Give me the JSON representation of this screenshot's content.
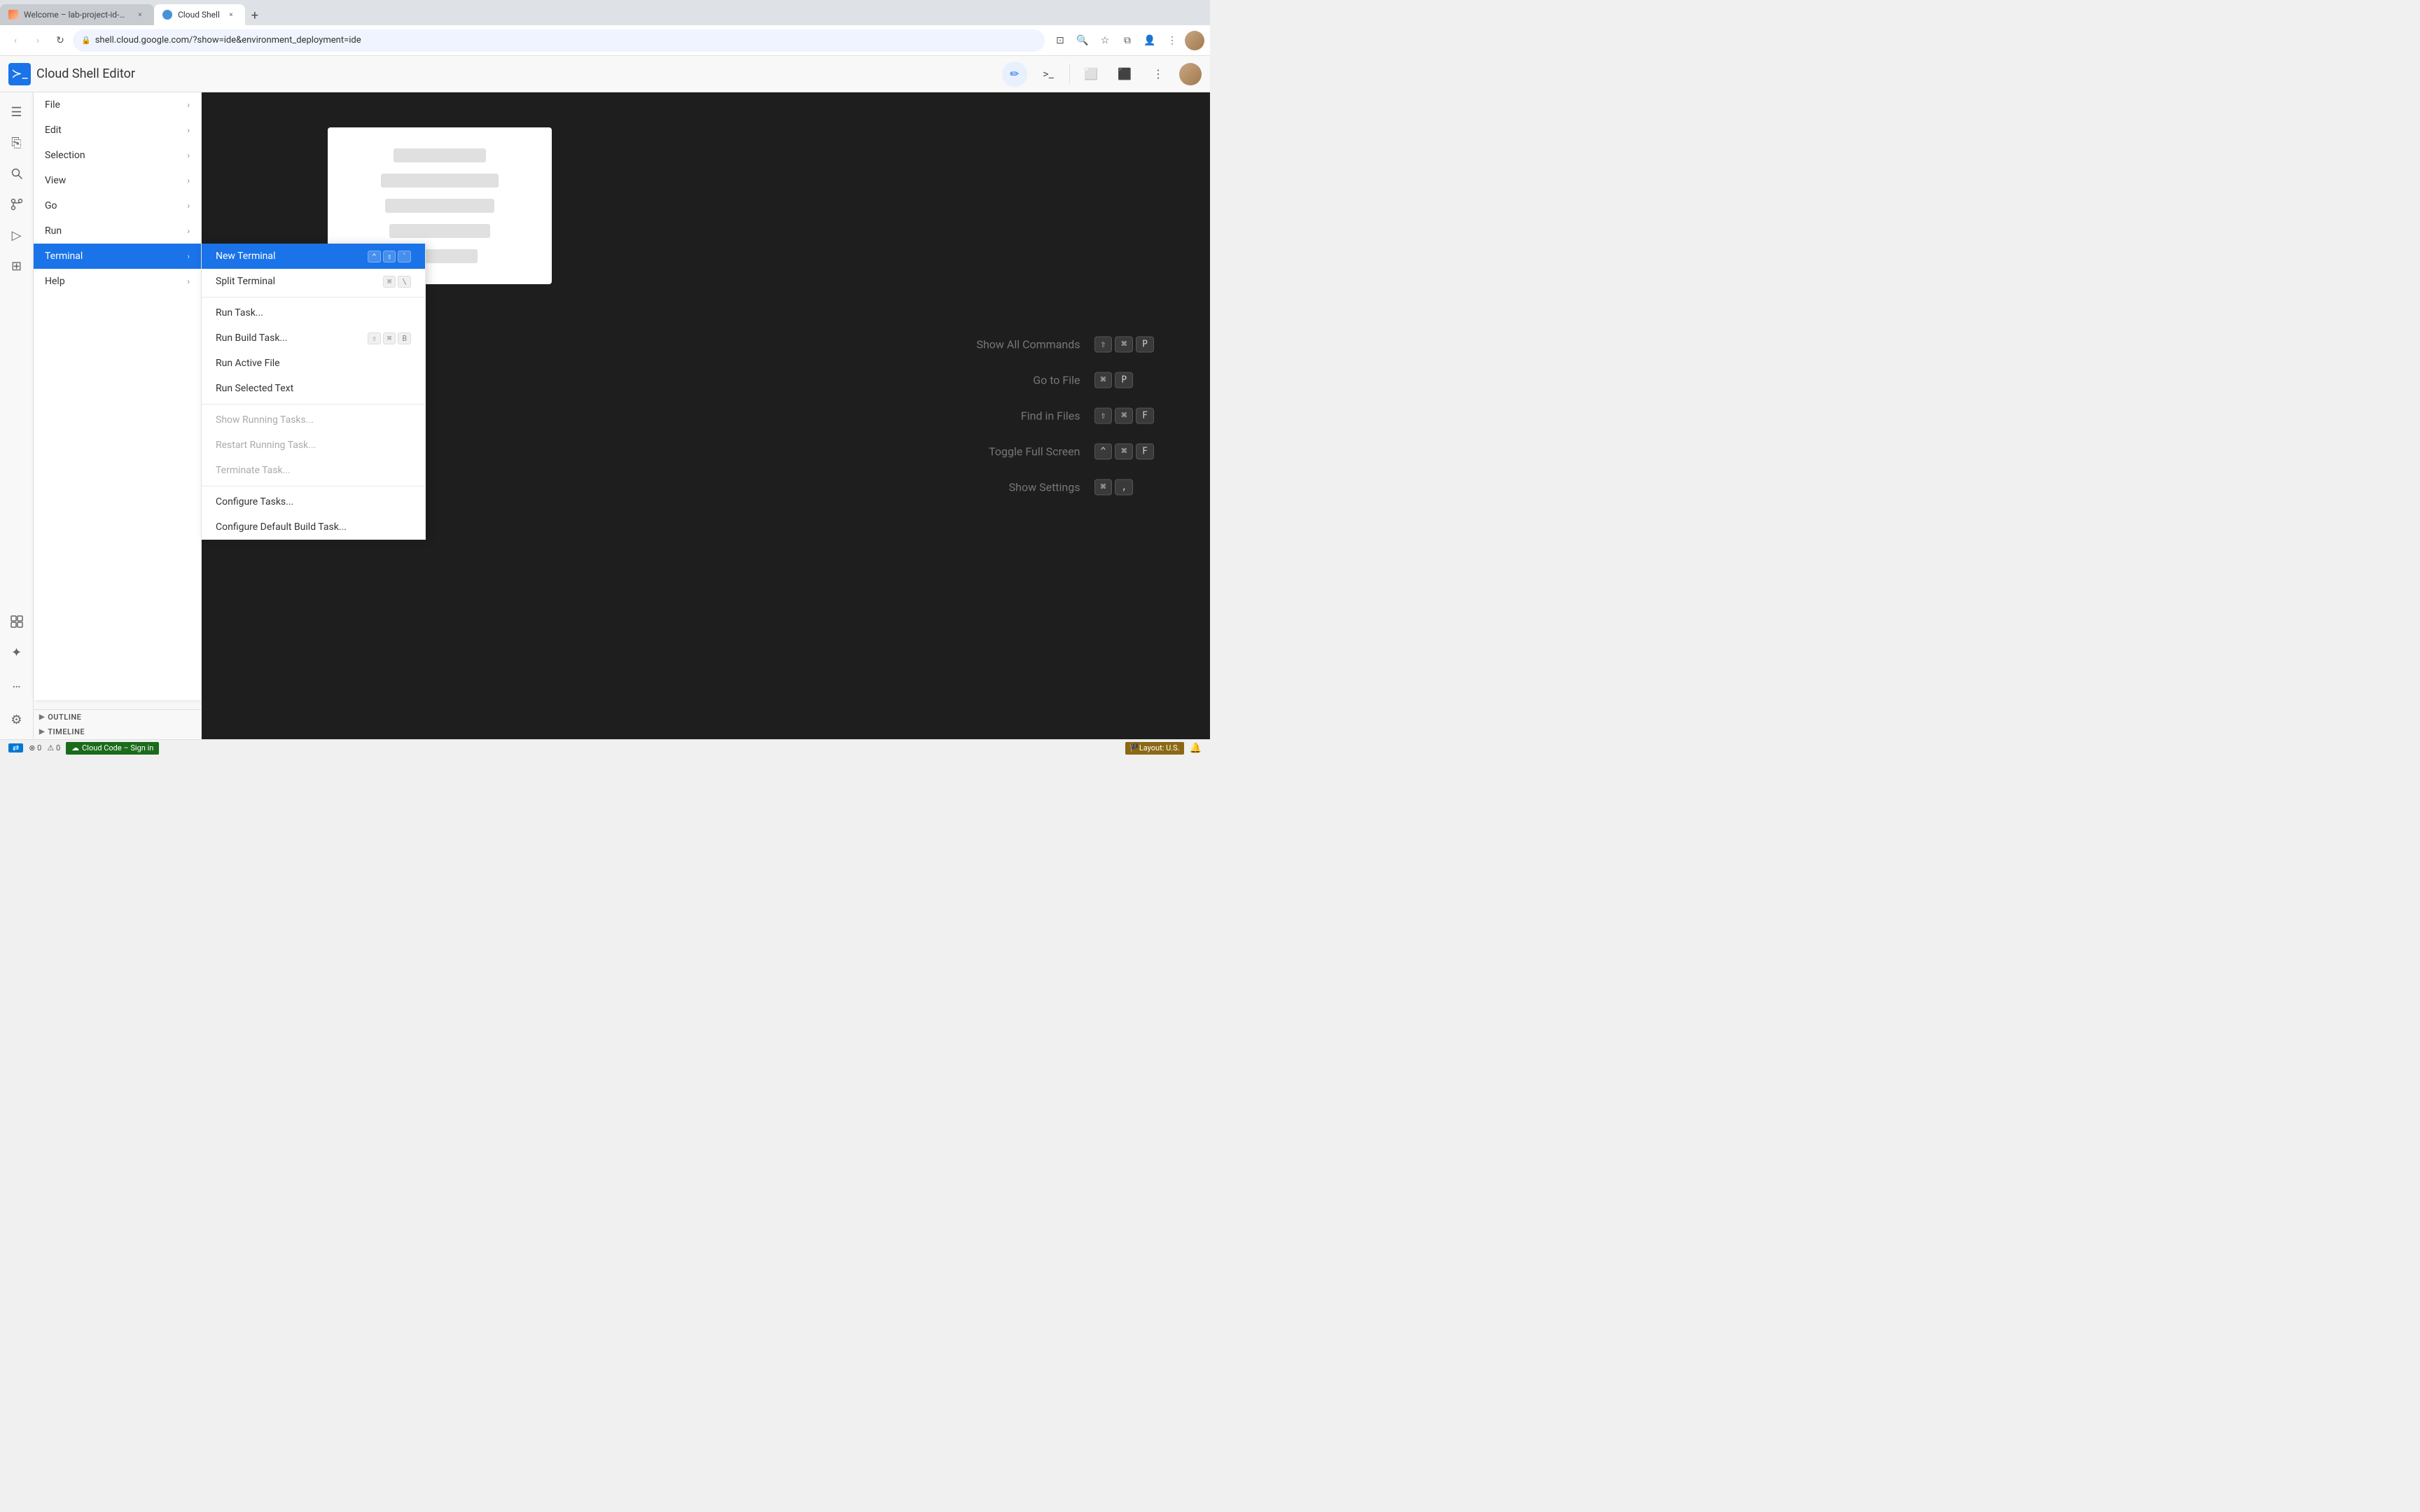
{
  "browser": {
    "tabs": [
      {
        "id": "welcome",
        "label": "Welcome – lab-project-id-e...",
        "active": false,
        "favicon": "welcome"
      },
      {
        "id": "cloudshell",
        "label": "Cloud Shell",
        "active": true,
        "favicon": "shell"
      }
    ],
    "new_tab_label": "+",
    "url": "shell.cloud.google.com/?show=ide&environment_deployment=ide",
    "nav": {
      "back": "‹",
      "forward": "›",
      "refresh": "↻"
    }
  },
  "app": {
    "logo_symbol": "≻_",
    "title": "Cloud Shell Editor",
    "header_buttons": [
      {
        "id": "edit-btn",
        "icon": "✏",
        "active": true
      },
      {
        "id": "terminal-btn",
        "icon": ">_",
        "active": false
      }
    ]
  },
  "activity_bar": {
    "items": [
      {
        "id": "menu",
        "icon": "☰"
      },
      {
        "id": "explorer",
        "icon": "⎘"
      },
      {
        "id": "search",
        "icon": "🔍"
      },
      {
        "id": "source-control",
        "icon": "⑂"
      },
      {
        "id": "run",
        "icon": "▶"
      },
      {
        "id": "extensions",
        "icon": "⊞"
      },
      {
        "id": "cloud",
        "icon": "❖"
      },
      {
        "id": "gemini",
        "icon": "✦"
      },
      {
        "id": "more",
        "icon": "…"
      }
    ]
  },
  "primary_menu": {
    "items": [
      {
        "id": "file",
        "label": "File",
        "has_submenu": true
      },
      {
        "id": "edit",
        "label": "Edit",
        "has_submenu": true
      },
      {
        "id": "selection",
        "label": "Selection",
        "has_submenu": true
      },
      {
        "id": "view",
        "label": "View",
        "has_submenu": true
      },
      {
        "id": "go",
        "label": "Go",
        "has_submenu": true
      },
      {
        "id": "run",
        "label": "Run",
        "has_submenu": true
      },
      {
        "id": "terminal",
        "label": "Terminal",
        "has_submenu": true,
        "active": true
      },
      {
        "id": "help",
        "label": "Help",
        "has_submenu": true
      }
    ]
  },
  "terminal_submenu": {
    "items": [
      {
        "id": "new-terminal",
        "label": "New Terminal",
        "shortcut": "⌃⇧`",
        "active": true
      },
      {
        "id": "split-terminal",
        "label": "Split Terminal",
        "shortcut": "⌘\\"
      },
      {
        "id": "divider1",
        "type": "divider"
      },
      {
        "id": "run-task",
        "label": "Run Task...",
        "shortcut": ""
      },
      {
        "id": "run-build-task",
        "label": "Run Build Task...",
        "shortcut": "⇧⌘B"
      },
      {
        "id": "run-active-file",
        "label": "Run Active File",
        "shortcut": ""
      },
      {
        "id": "run-selected-text",
        "label": "Run Selected Text",
        "shortcut": ""
      },
      {
        "id": "divider2",
        "type": "divider"
      },
      {
        "id": "show-running-tasks",
        "label": "Show Running Tasks...",
        "shortcut": "",
        "disabled": true
      },
      {
        "id": "restart-running-task",
        "label": "Restart Running Task...",
        "shortcut": "",
        "disabled": true
      },
      {
        "id": "terminate-task",
        "label": "Terminate Task...",
        "shortcut": "",
        "disabled": true
      },
      {
        "id": "divider3",
        "type": "divider"
      },
      {
        "id": "configure-tasks",
        "label": "Configure Tasks...",
        "shortcut": ""
      },
      {
        "id": "configure-default-build-task",
        "label": "Configure Default Build Task...",
        "shortcut": ""
      }
    ]
  },
  "shortcuts": [
    {
      "label": "Show All Commands",
      "keys": [
        "⇧",
        "⌘",
        "P"
      ]
    },
    {
      "label": "Go to File",
      "keys": [
        "⌘",
        "P"
      ]
    },
    {
      "label": "Find in Files",
      "keys": [
        "⇧",
        "⌘",
        "F"
      ]
    },
    {
      "label": "Toggle Full Screen",
      "keys": [
        "^",
        "⌘",
        "F"
      ]
    },
    {
      "label": "Show Settings",
      "keys": [
        "⌘",
        ","
      ]
    }
  ],
  "sidebar_sections": [
    {
      "id": "outline",
      "label": "OUTLINE"
    },
    {
      "id": "timeline",
      "label": "TIMELINE"
    }
  ],
  "status_bar": {
    "errors": "0",
    "warnings": "0",
    "cloud_code_label": "Cloud Code – Sign in",
    "layout_label": "Layout: U.S."
  }
}
